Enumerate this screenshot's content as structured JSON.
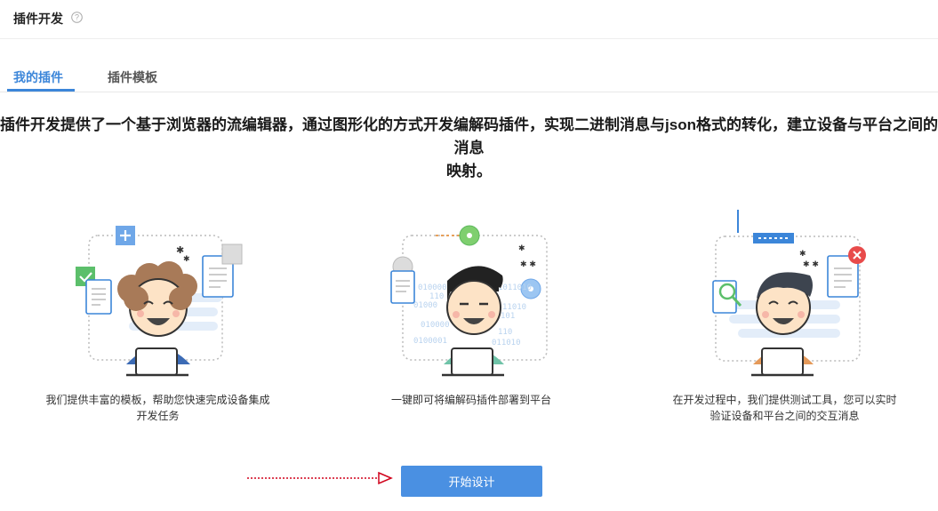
{
  "header": {
    "title": "插件开发",
    "help_icon": "question-circle-icon"
  },
  "tabs": [
    {
      "label": "我的插件",
      "active": true
    },
    {
      "label": "插件模板",
      "active": false
    }
  ],
  "intro": {
    "line1": "插件开发提供了一个基于浏览器的流编辑器，通过图形化的方式开发编解码插件，实现二进制消息与json格式的转化，建立设备与平台之间的消息",
    "line2": "映射。"
  },
  "features": [
    {
      "icon": "developer-with-templates-illustration",
      "line1": "我们提供丰富的模板，帮助您快速完成设备集成",
      "line2": "开发任务"
    },
    {
      "icon": "developer-one-click-deploy-illustration",
      "line1": "一键即可将编解码插件部署到平台",
      "line2": ""
    },
    {
      "icon": "developer-testing-tools-illustration",
      "line1": "在开发过程中，我们提供测试工具，您可以实时",
      "line2": "验证设备和平台之间的交互消息"
    }
  ],
  "binary_text": [
    "0100001",
    "110",
    "01000",
    "1011010",
    "010000",
    "11010",
    "0100001",
    "101",
    "110",
    "011010"
  ],
  "action": {
    "start_label": "开始设计"
  },
  "colors": {
    "accent": "#4a90e2",
    "tab_active": "#3c86d9",
    "arrow": "#d0021b"
  }
}
